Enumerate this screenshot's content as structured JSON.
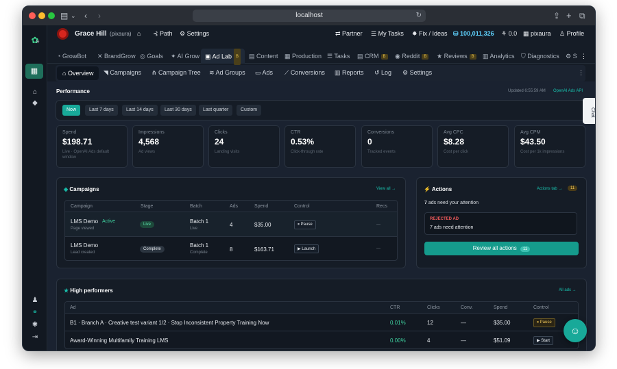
{
  "browser": {
    "url": "localhost"
  },
  "topbar": {
    "user": "Grace Hill",
    "handle": "(pixaura)",
    "path_label": "Path",
    "settings_label": "Settings",
    "partner_label": "Partner",
    "mytasks_label": "My Tasks",
    "fix_label": "Fix / Ideas",
    "credits": "100,011,326",
    "score": "0.0",
    "brand": "pixaura",
    "profile_label": "Profile"
  },
  "tabs1": [
    {
      "label": "GrowBot"
    },
    {
      "label": "BrandGrow"
    },
    {
      "label": "Goals"
    },
    {
      "label": "AI Grow"
    },
    {
      "label": "Ad Lab",
      "badge": "B"
    },
    {
      "label": "Content"
    },
    {
      "label": "Production"
    },
    {
      "label": "Tasks"
    },
    {
      "label": "CRM",
      "badge": "B"
    },
    {
      "label": "Reddit",
      "badge": "B"
    },
    {
      "label": "Reviews",
      "badge": "B"
    },
    {
      "label": "Analytics"
    },
    {
      "label": "Diagnostics"
    },
    {
      "label": "S"
    }
  ],
  "tabs2": [
    {
      "label": "Overview"
    },
    {
      "label": "Campaigns"
    },
    {
      "label": "Campaign Tree"
    },
    {
      "label": "Ad Groups"
    },
    {
      "label": "Ads"
    },
    {
      "label": "Conversions"
    },
    {
      "label": "Reports"
    },
    {
      "label": "Log"
    },
    {
      "label": "Settings"
    }
  ],
  "performance": {
    "title": "Performance",
    "updated": "Updated 6:55:59 AM",
    "api_link": "OpenAI Ads API",
    "ranges": [
      "Now",
      "Last 7 days",
      "Last 14 days",
      "Last 30 days",
      "Last quarter",
      "Custom"
    ]
  },
  "stats": [
    {
      "label": "Spend",
      "value": "$198.71",
      "sub": "Live · OpenAI Ads default window"
    },
    {
      "label": "Impressions",
      "value": "4,568",
      "sub": "Ad views"
    },
    {
      "label": "Clicks",
      "value": "24",
      "sub": "Landing visits"
    },
    {
      "label": "CTR",
      "value": "0.53%",
      "sub": "Click-through rate"
    },
    {
      "label": "Conversions",
      "value": "0",
      "sub": "Tracked events"
    },
    {
      "label": "Avg CPC",
      "value": "$8.28",
      "sub": "Cost per click"
    },
    {
      "label": "Avg CPM",
      "value": "$43.50",
      "sub": "Cost per 1k impressions"
    }
  ],
  "campaigns": {
    "title": "Campaigns",
    "view_all": "View all →",
    "columns": [
      "Campaign",
      "Stage",
      "Batch",
      "Ads",
      "Spend",
      "Control",
      "Recs"
    ],
    "rows": [
      {
        "name": "LMS Demo",
        "status": "Active",
        "sub": "Page viewed",
        "stage": "Live",
        "batch": "Batch 1",
        "batch_sub": "Live",
        "ads": "4",
        "spend": "$35.00",
        "control": "Pause",
        "recs": "—"
      },
      {
        "name": "LMS Demo",
        "status": "",
        "sub": "Lead created",
        "stage": "Complete",
        "batch": "Batch 1",
        "batch_sub": "Complete",
        "ads": "8",
        "spend": "$163.71",
        "control": "Launch",
        "recs": "—"
      }
    ]
  },
  "actions": {
    "title": "Actions",
    "tab_link": "Actions tab →",
    "count": "11",
    "attention_prefix": "7",
    "attention_text": "ads need your attention",
    "rejected_label": "REJECTED AD",
    "rejected_text": "7 ads need attention",
    "review_label": "Review all actions",
    "review_count": "11"
  },
  "high_performers": {
    "title": "High performers",
    "all_ads": "All ads →",
    "columns": [
      "Ad",
      "CTR",
      "Clicks",
      "Conv.",
      "Spend",
      "Control"
    ],
    "rows": [
      {
        "ad": "B1 · Branch A · Creative test variant 1/2 · Stop Inconsistent Property Training Now",
        "ctr": "0.01%",
        "clicks": "12",
        "conv": "—",
        "spend": "$35.00",
        "control": "Pause"
      },
      {
        "ad": "Award-Winning Multifamily Training LMS",
        "ctr": "0.00%",
        "clicks": "4",
        "conv": "—",
        "spend": "$51.09",
        "control": "Start"
      }
    ]
  },
  "chat_label": "Chat",
  "colors": {
    "accent": "#18a999",
    "bg": "#151c26",
    "panel": "#1a2230",
    "badge": "#e8c24a"
  }
}
